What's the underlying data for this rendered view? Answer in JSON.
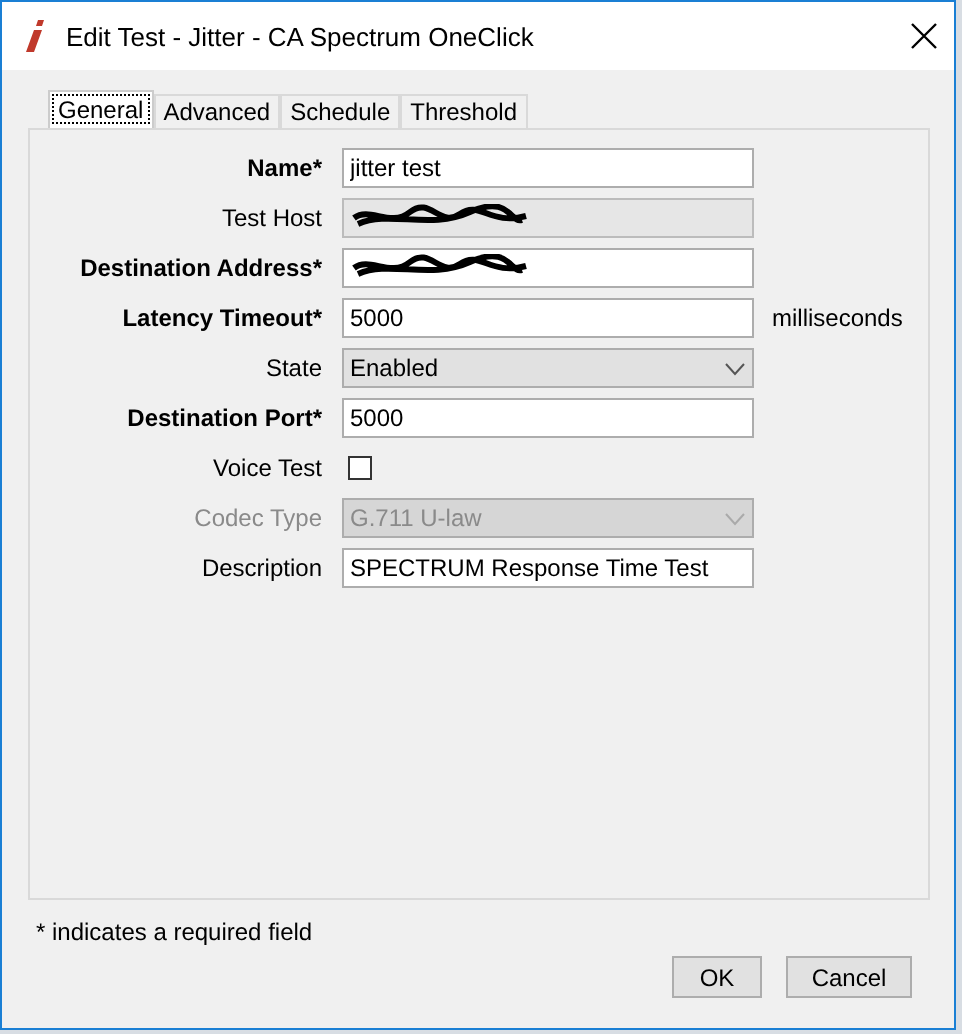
{
  "window": {
    "title": "Edit Test - Jitter - CA Spectrum OneClick"
  },
  "tabs": [
    {
      "label": "General",
      "selected": true
    },
    {
      "label": "Advanced",
      "selected": false
    },
    {
      "label": "Schedule",
      "selected": false
    },
    {
      "label": "Threshold",
      "selected": false
    }
  ],
  "fields": [
    {
      "kind": "text",
      "label": "Name*",
      "required": true,
      "value": "jitter test"
    },
    {
      "kind": "redacted",
      "label": "Test Host",
      "required": false,
      "readonly": true
    },
    {
      "kind": "redacted",
      "label": "Destination Address*",
      "required": true,
      "readonly": false
    },
    {
      "kind": "text",
      "label": "Latency Timeout*",
      "required": true,
      "value": "5000",
      "unit": "milliseconds"
    },
    {
      "kind": "select",
      "label": "State",
      "required": false,
      "value": "Enabled",
      "disabled": false
    },
    {
      "kind": "text",
      "label": "Destination Port*",
      "required": true,
      "value": "5000"
    },
    {
      "kind": "checkbox",
      "label": "Voice Test",
      "required": false,
      "checked": false
    },
    {
      "kind": "select",
      "label": "Codec Type",
      "required": false,
      "value": "G.711 U-law",
      "disabled": true
    },
    {
      "kind": "text",
      "label": "Description",
      "required": false,
      "value": "SPECTRUM Response Time Test"
    }
  ],
  "footnote": "* indicates a required field",
  "buttons": [
    "OK",
    "Cancel"
  ]
}
